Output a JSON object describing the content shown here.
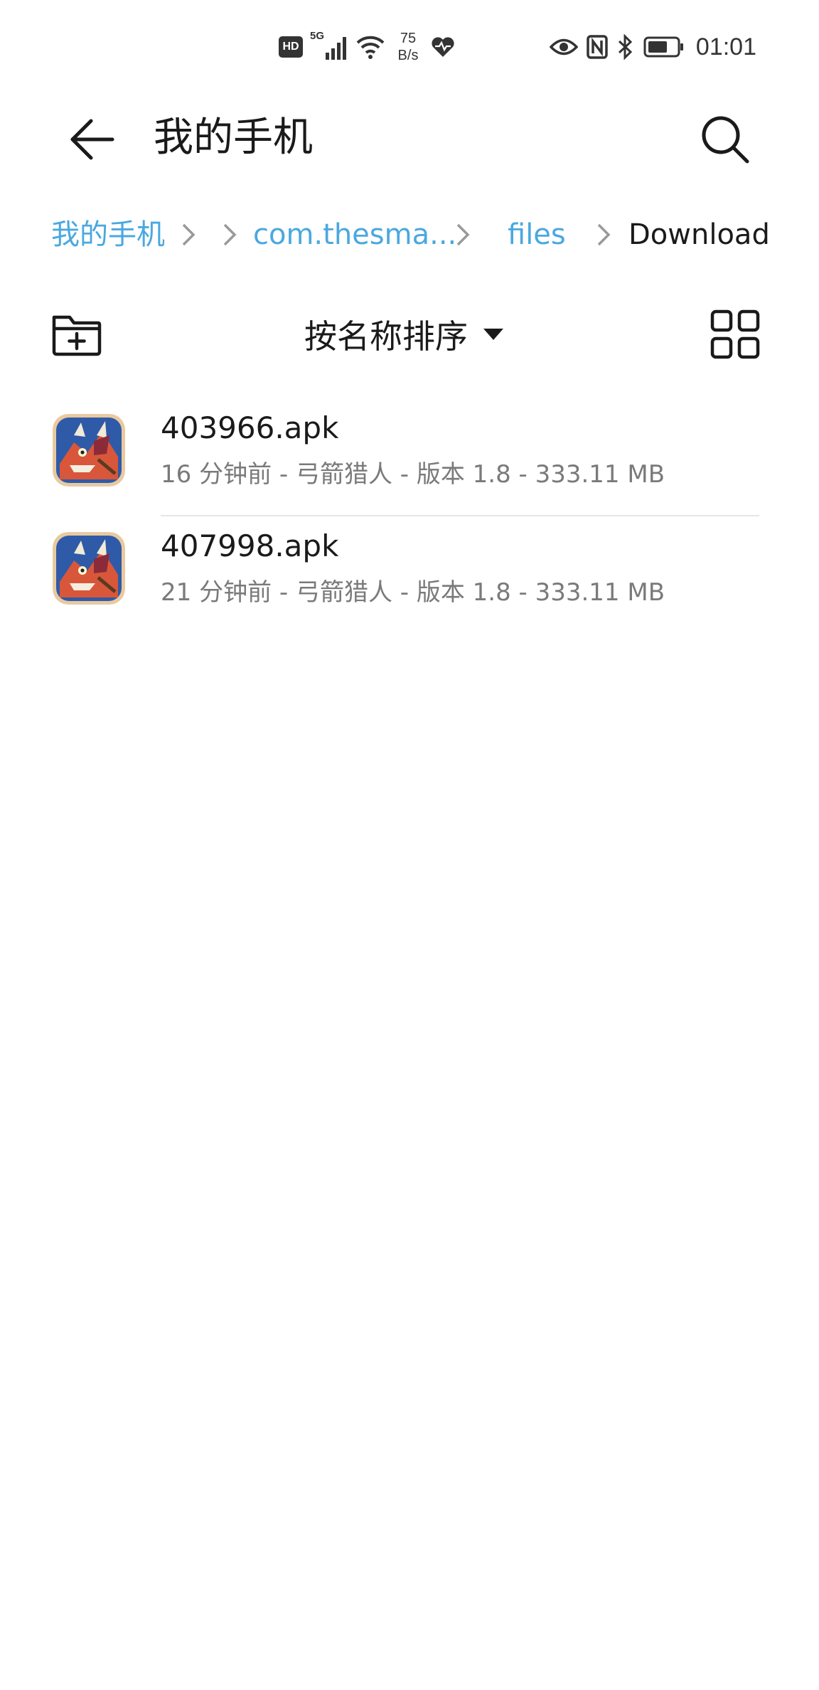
{
  "status_bar": {
    "hd_badge": "HD",
    "network_type": "5G",
    "speed_value": "75",
    "speed_unit": "B/s",
    "time": "01:01"
  },
  "header": {
    "title": "我的手机"
  },
  "breadcrumb": {
    "items": [
      "我的手机",
      "com.thesma...",
      "files",
      "Download"
    ]
  },
  "toolbar": {
    "sort_label": "按名称排序"
  },
  "files": [
    {
      "name": "403966.apk",
      "meta": "16 分钟前 - 弓箭猎人 - 版本 1.8 - 333.11 MB"
    },
    {
      "name": "407998.apk",
      "meta": "21 分钟前 - 弓箭猎人 - 版本 1.8 - 333.11 MB"
    }
  ],
  "colors": {
    "link": "#4aa8e0",
    "text": "#1a1a1a",
    "secondary": "#7a7a7a"
  }
}
